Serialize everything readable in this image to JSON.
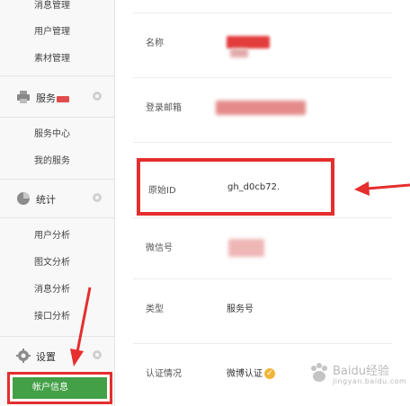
{
  "sidebar": {
    "top_items": [
      {
        "label": "消息管理"
      },
      {
        "label": "用户管理"
      },
      {
        "label": "素材管理"
      }
    ],
    "service_section": {
      "label": "服务",
      "icon": "printer-icon"
    },
    "service_items": [
      {
        "label": "服务中心"
      },
      {
        "label": "我的服务"
      }
    ],
    "stats_section": {
      "label": "统计",
      "icon": "pie-chart-icon"
    },
    "stats_items": [
      {
        "label": "用户分析"
      },
      {
        "label": "图文分析"
      },
      {
        "label": "消息分析"
      },
      {
        "label": "接口分析"
      }
    ],
    "settings_section": {
      "label": "设置",
      "icon": "gear-icon"
    },
    "account_button": {
      "label": "帐户信息"
    }
  },
  "account_info": {
    "rows": [
      {
        "label": "名称",
        "value": ""
      },
      {
        "label": "登录邮箱",
        "value": ""
      },
      {
        "label": "原始ID",
        "value": "gh_d0cb72."
      },
      {
        "label": "微信号",
        "value": ""
      },
      {
        "label": "类型",
        "value": "服务号"
      },
      {
        "label": "认证情况",
        "value": "微博认证"
      }
    ]
  },
  "watermark": {
    "text": "Baidu经验",
    "sub": "jingyan.baidu.com"
  },
  "colors": {
    "highlight": "#e52e2e",
    "active_green": "#43a047",
    "badge": "#e14b4b"
  }
}
